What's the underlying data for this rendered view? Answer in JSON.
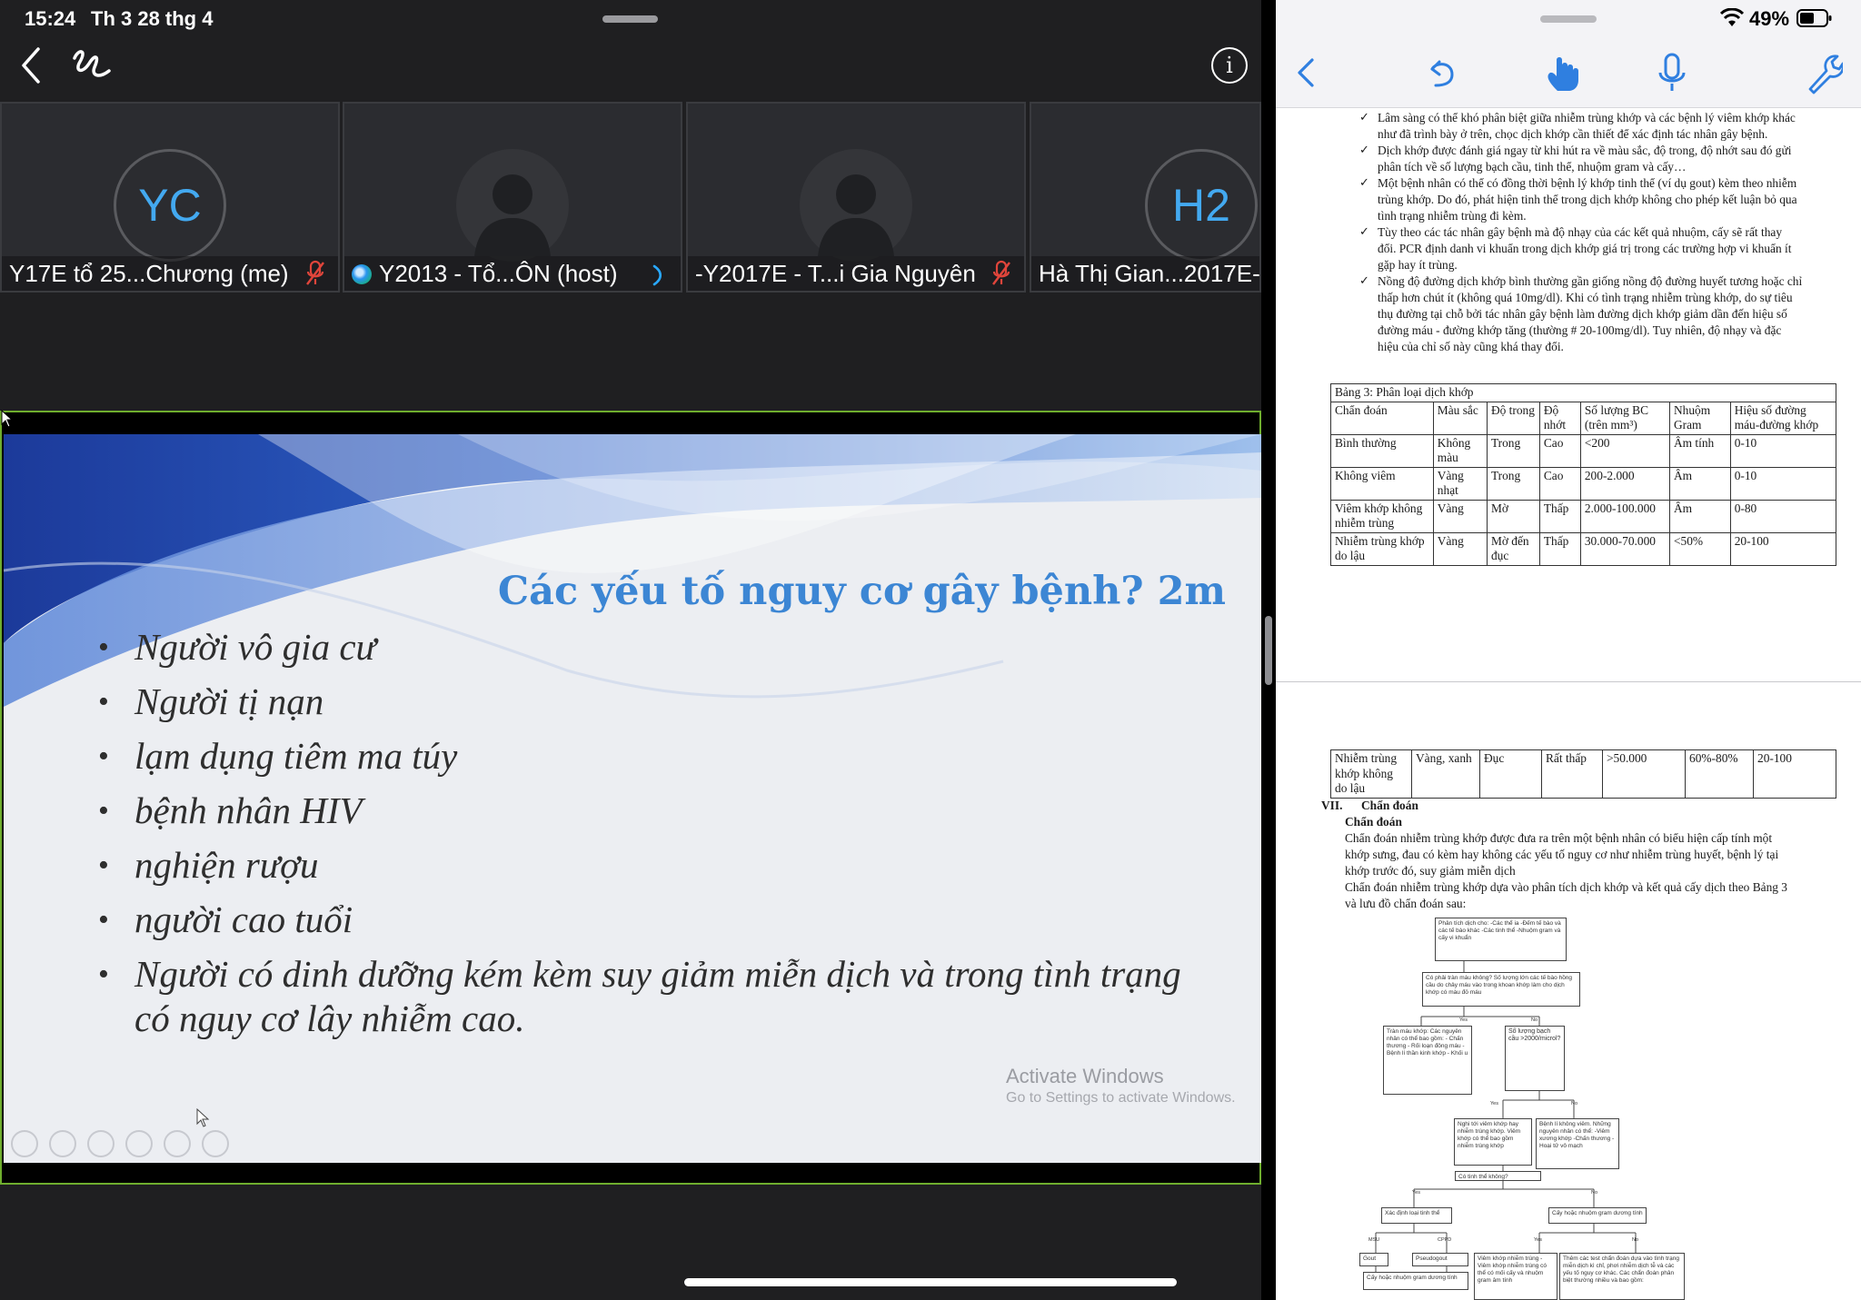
{
  "status_bar": {
    "time": "15:24",
    "date": "Th 3 28 thg 4",
    "battery_percent": "49%"
  },
  "participants": [
    {
      "initials": "YC",
      "name": "Y17E tổ 25...Chương (me)",
      "muted": true,
      "type": "initials"
    },
    {
      "initials": "",
      "name": "Y2013 - Tổ...ÔN (host)",
      "muted": false,
      "type": "photo"
    },
    {
      "initials": "",
      "name": "-Y2017E - T...i Gia Nguyên",
      "muted": true,
      "type": "photo"
    },
    {
      "initials": "H2",
      "name": "Hà Thị Gian...2017E-",
      "muted": false,
      "type": "initials"
    }
  ],
  "slide": {
    "title": "Các yếu tố nguy cơ gây bệnh? 2m",
    "bullets": [
      "Người vô gia cư",
      "Người tị nạn",
      "lạm dụng tiêm ma túy",
      "bệnh nhân HIV",
      "nghiện rượu",
      "người cao tuổi",
      "Người có dinh dưỡng kém kèm suy giảm miễn dịch và trong tình trạng có nguy cơ lây nhiễm cao."
    ],
    "watermark_title": "Activate Windows",
    "watermark_subtitle": "Go to Settings to activate Windows."
  },
  "document": {
    "bullets": [
      "Lâm sàng có thể khó phân biệt giữa nhiễm trùng khớp và các bệnh lý viêm khớp khác như đã trình bày ở trên, chọc dịch khớp cần thiết để xác định tác nhân gây bệnh.",
      "Dịch khớp được đánh giá ngay từ khi hút ra về màu sắc, độ trong, độ nhớt sau đó gửi phân tích về số lượng bạch cầu, tinh thể, nhuộm gram và cấy…",
      "Một bệnh nhân có thể có đồng thời bệnh lý khớp tinh thể (ví dụ gout) kèm theo nhiễm trùng khớp. Do đó, phát hiện tinh thể trong dịch khớp không cho phép kết luận bỏ qua tình trạng nhiễm trùng đi kèm.",
      "Tùy theo các tác nhân gây bệnh mà độ nhạy của các kết quả nhuộm, cấy sẽ rất thay đổi. PCR định danh vi khuẩn trong dịch khớp giá trị trong các trường hợp vi khuẩn ít gặp hay ít trùng.",
      "Nồng độ đường dịch khớp bình thường gần giống nồng độ đường huyết tương hoặc chỉ thấp hơn chút ít (không quá 10mg/dl). Khi có tình trạng nhiễm trùng khớp, do sự tiêu thụ đường tại chỗ bởi tác nhân gây bệnh làm đường dịch khớp giảm dần đến hiệu số đường máu - đường khớp tăng (thường # 20-100mg/dl). Tuy nhiên, độ nhạy và đặc hiệu của chỉ số này cũng khá thay đổi."
    ],
    "table_caption": "Bảng 3: Phân loại dịch khớp",
    "table_headers": [
      "Chẩn đoán",
      "Màu sắc",
      "Độ trong",
      "Độ nhớt",
      "Số lượng BC (trên mm³)",
      "Nhuộm Gram",
      "Hiệu số đường máu-đường khớp"
    ],
    "table_rows": [
      [
        "Bình thường",
        "Không màu",
        "Trong",
        "Cao",
        "<200",
        "Âm tính",
        "0-10"
      ],
      [
        "Không viêm",
        "Vàng nhạt",
        "Trong",
        "Cao",
        "200-2.000",
        "Âm",
        "0-10"
      ],
      [
        "Viêm khớp không nhiễm trùng",
        "Vàng",
        "Mờ",
        "Thấp",
        "2.000-100.000",
        "Âm",
        "0-80"
      ],
      [
        "Nhiễm trùng khớp do lậu",
        "Vàng",
        "Mờ đến đục",
        "Thấp",
        "30.000-70.000",
        "<50%",
        "20-100"
      ]
    ],
    "table2_row": [
      "Nhiễm trùng khớp không do lậu",
      "Vàng, xanh",
      "Đục",
      "Rất thấp",
      ">50.000",
      "60%-80%",
      "20-100"
    ],
    "section_number": "VII.",
    "section_title": "Chẩn đoán",
    "subsection_title": "Chẩn đoán",
    "para1": "Chẩn đoán nhiễm trùng khớp được đưa ra trên một bệnh nhân có biểu hiện cấp tính một khớp sưng, đau có kèm hay không các yếu tố nguy cơ như nhiễm trùng huyết, bệnh lý tại khớp trước đó, suy giảm miễn dịch",
    "para2": "Chẩn đoán nhiễm trùng khớp dựa vào phân tích dịch khớp và kết quả cấy dịch theo Bảng 3 và lưu đồ chẩn đoán sau:",
    "flowchart": {
      "box1": "Phân tích dịch cho: -Các thể ia -Đếm tế bào và các tế bào khác -Các tinh thể -Nhuộm gram và cấy vi khuẩn",
      "box2": "Có phải tràn máu không? Số lượng lớn các tế bào hồng cầu do chảy máu vào trong khoan khớp làm cho dịch khớp có màu đỏ máu",
      "box3": "Tràn máu khớp: Các nguyên nhân có thể bao gồm: - Chấn thương - Rối loạn đông máu - Bệnh lí thần kinh khớp - Khối u",
      "box4": "Số lượng bạch cầu >2000/microl?",
      "box5": "Nghi tới viêm khớp hay nhiễm trùng khớp. Viêm khớp có thể bao gồm nhiễm trùng khớp",
      "box6": "Bệnh lí không viêm. Những nguyên nhân có thể: -Viêm xương khớp -Chấn thương -Hoại tử vô mạch",
      "box7": "Có tinh thể không?",
      "box8": "Xác định loại tinh thể",
      "box9": "Cấy hoặc nhuộm gram dương tính",
      "box10": "Gout",
      "box11": "Pseudogout",
      "box12": "Cấy hoặc nhuộm gram dương tính",
      "box13": "Viêm khớp nhiễm trùng -Viêm khớp nhiễm trùng có thể có mối cấy và nhuộm gram âm tính",
      "box14": "Thêm các test chẩn đoán dựa vào tình trạng miễn dịch kì chỉ, phơi nhiễm dịch tễ và các yếu tố nguy cơ khác. Các chẩn đoán phân biệt thường nhiều và bao gồm:",
      "yes": "Yes",
      "no": "No",
      "msu": "MSU",
      "cppd": "CPPD"
    }
  },
  "colors": {
    "zoom_bg": "#1f1f21",
    "accent_blue": "#3c86d4",
    "share_border": "#6fae2e",
    "mute_red": "#e0453b",
    "toolbar_blue": "#2f7fe0"
  },
  "icons": {
    "back": "chevron-left-icon",
    "annotate": "annotate-icon",
    "info": "info-icon",
    "undo": "undo-icon",
    "touch": "hand-touch-icon",
    "mic": "microphone-icon",
    "tools": "wrench-icon",
    "wifi": "wifi-icon",
    "battery": "battery-icon"
  }
}
